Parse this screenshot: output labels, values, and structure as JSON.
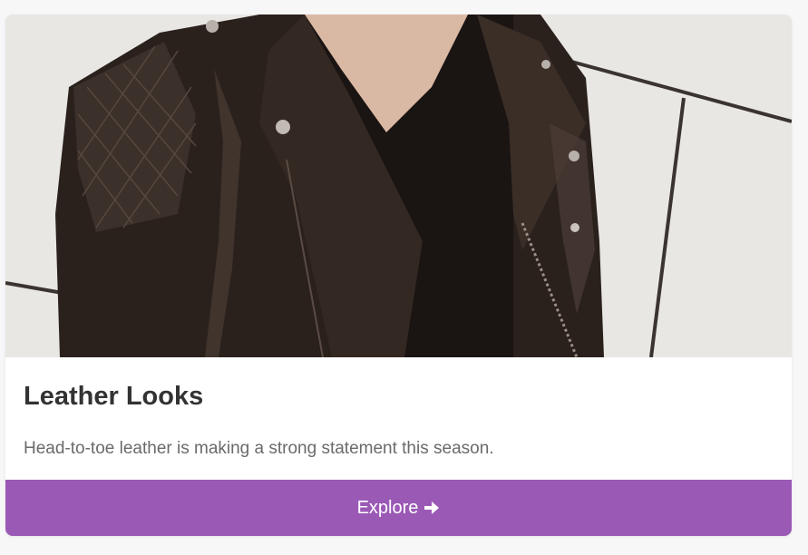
{
  "card": {
    "title": "Leather Looks",
    "description": "Head-to-toe leather is making a strong statement this season.",
    "button_label": "Explore",
    "button_icon": "arrow-right-icon",
    "image_subject": "leather-jacket-photo"
  },
  "colors": {
    "accent": "#9b59b6",
    "title": "#333333",
    "text": "#6a6a6a",
    "background": "#f7f7f8"
  }
}
